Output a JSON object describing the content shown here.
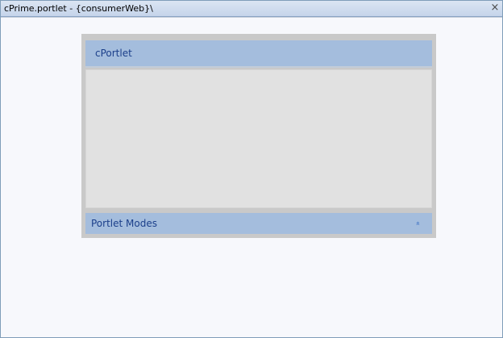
{
  "editor": {
    "tab_title": "cPrime.portlet - {consumerWeb}\\",
    "close_glyph": "×"
  },
  "portlet": {
    "title": "cPortlet",
    "modes_label": "Portlet Modes",
    "modes_toggle_glyph": "»"
  },
  "colors": {
    "title_bar": "#a4bddd",
    "title_text": "#1b3f8a",
    "portlet_frame": "#c9c9c9",
    "portlet_body": "#e1e1e1",
    "canvas": "#f7f8fc"
  },
  "icons": {
    "close": "close-icon",
    "collapse": "chevron-up-icon"
  }
}
